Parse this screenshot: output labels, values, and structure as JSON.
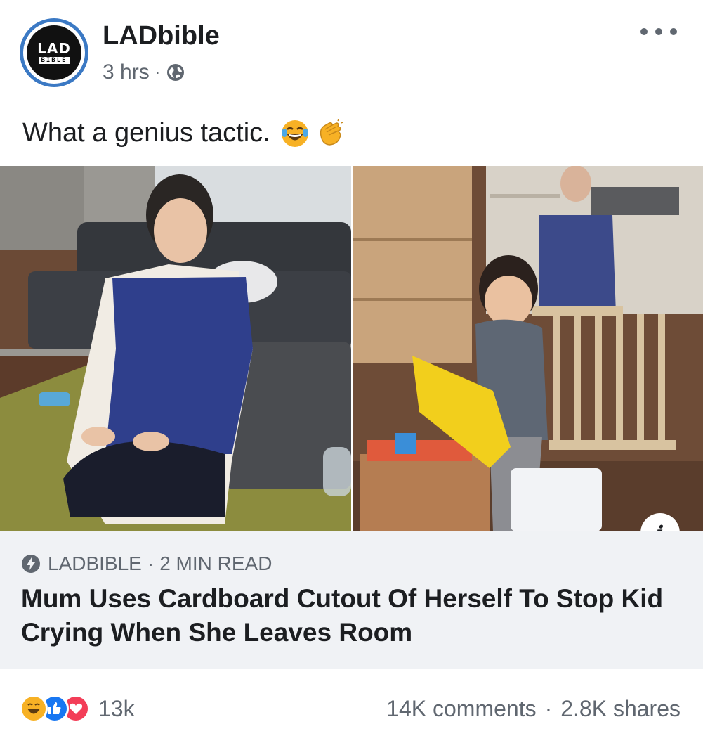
{
  "post": {
    "page_name": "LADbible",
    "avatar_logo": {
      "line1": "LAD",
      "line2": "BIBLE"
    },
    "time": "3 hrs",
    "separator": "·",
    "audience_icon": "globe-icon",
    "caption": "What a genius tactic.",
    "caption_emojis": [
      "laughing-crying-emoji",
      "clapping-hands-emoji"
    ]
  },
  "link": {
    "source_icon": "bolt-icon",
    "source": "LADBIBLE",
    "separator": "·",
    "read_time": "2 MIN READ",
    "headline": "Mum Uses Cardboard Cutout Of Herself To Stop Kid Crying When She Leaves Room"
  },
  "footer": {
    "reaction_icons": [
      "haha-icon",
      "like-icon",
      "love-icon"
    ],
    "reaction_count": "13k",
    "comments": "14K comments",
    "separator": "·",
    "shares": "2.8K shares"
  },
  "colors": {
    "like": "#1877f2",
    "love": "#f33e58",
    "haha": "#f7b125",
    "meta_text": "#606770",
    "preview_bg": "#f0f2f5",
    "avatar_ring": "#3b79c4"
  }
}
